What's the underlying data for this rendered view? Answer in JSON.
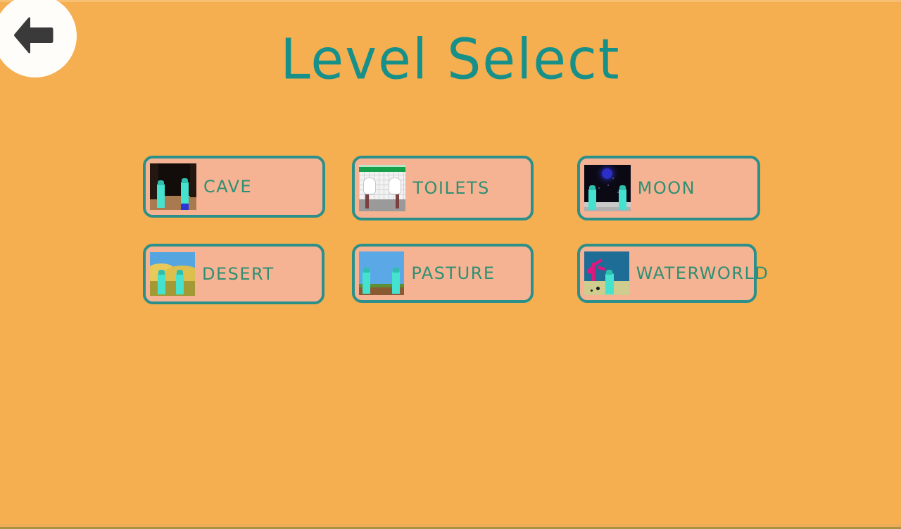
{
  "screen": {
    "title": "Level Select",
    "background_color": "#f5af51",
    "accent_color": "#2b9089",
    "card_fill_color": "#f6b394",
    "label_color": "#2f8f72"
  },
  "back_button": {
    "name": "back",
    "icon": "arrow-left-icon",
    "circle_color": "#fffdfa",
    "arrow_color": "#3a3a3a"
  },
  "levels": [
    {
      "id": "cave",
      "label": "CAVE",
      "thumbnail": "cave-thumbnail"
    },
    {
      "id": "toilets",
      "label": "TOILETS",
      "thumbnail": "toilets-thumbnail"
    },
    {
      "id": "moon",
      "label": "MOON",
      "thumbnail": "moon-thumbnail"
    },
    {
      "id": "desert",
      "label": "DESERT",
      "thumbnail": "desert-thumbnail"
    },
    {
      "id": "pasture",
      "label": "PASTURE",
      "thumbnail": "pasture-thumbnail"
    },
    {
      "id": "waterworld",
      "label": "WATERWORLD",
      "thumbnail": "waterworld-thumbnail"
    }
  ]
}
